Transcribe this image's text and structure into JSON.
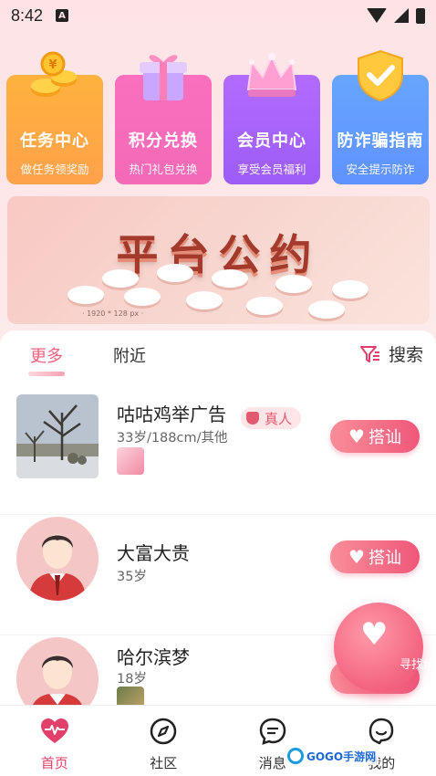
{
  "status_bar": {
    "time": "8:42",
    "sim_label": "A"
  },
  "features": [
    {
      "title": "任务中心",
      "subtitle": "做任务领奖励",
      "icon": "gold-coins-icon"
    },
    {
      "title": "积分兑换",
      "subtitle": "热门礼包兑换",
      "icon": "gift-box-icon"
    },
    {
      "title": "会员中心",
      "subtitle": "享受会员福利",
      "icon": "crown-icon"
    },
    {
      "title": "防诈骗指南",
      "subtitle": "安全提示防诈",
      "icon": "shield-check-icon"
    }
  ],
  "banner": {
    "headline": "平台公约",
    "caption": "· 1920 * 128 px ·"
  },
  "tabs": {
    "more": "更多",
    "nearby": "附近",
    "search": "搜索"
  },
  "users": [
    {
      "name": "咕咕鸡举广告",
      "verified_label": "真人",
      "meta": "33岁/188cm/其他",
      "button": "搭讪",
      "has_thumb": true
    },
    {
      "name": "大富大贵",
      "meta": "35岁",
      "button": "搭讪"
    },
    {
      "name": "哈尔滨梦",
      "meta": "18岁",
      "button": "搭讪",
      "has_thumb": true
    }
  ],
  "fate_button": {
    "label": "寻找缘分"
  },
  "nav": {
    "home": "首页",
    "community": "社区",
    "messages": "消息",
    "mine": "我的"
  },
  "watermark": {
    "text": "GOGO手游网"
  },
  "colors": {
    "accent": "#f0577a",
    "nav_active": "#e2406a"
  }
}
